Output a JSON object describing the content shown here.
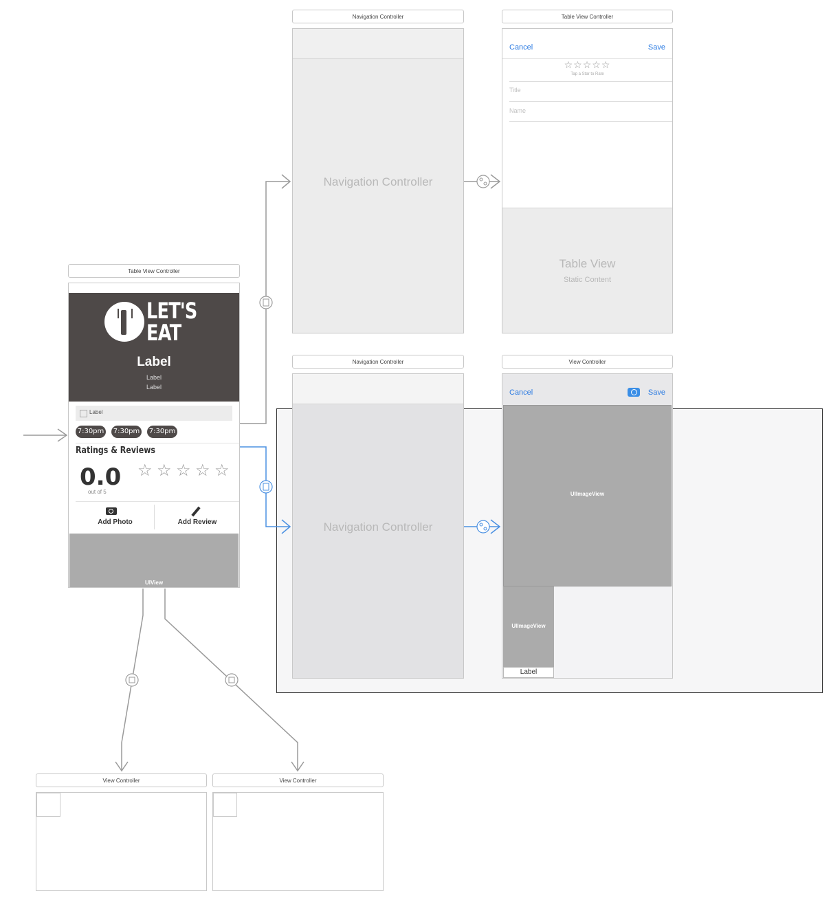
{
  "scenes": {
    "nav1_title": "Navigation Controller",
    "nav1_center": "Navigation Controller",
    "tvc_title": "Table View Controller",
    "tvc_cancel": "Cancel",
    "tvc_save": "Save",
    "tvc_rating_hint": "Tap a Star to Rate",
    "tvc_field_title": "Title",
    "tvc_field_name": "Name",
    "tvc_table_view": "Table View",
    "tvc_static": "Static Content",
    "main_title": "Table View Controller",
    "logo_top": "LET'S",
    "logo_bottom": "EAT",
    "header_label": "Label",
    "header_sub1": "Label",
    "header_sub2": "Label",
    "map_label": "Label",
    "times": [
      "7:30pm",
      "7:30pm",
      "7:30pm"
    ],
    "ratings_heading": "Ratings & Reviews",
    "rating_value": "0.0",
    "rating_out_of": "out of 5",
    "add_photo": "Add Photo",
    "add_review": "Add Review",
    "uiview": "UIView",
    "nav2_title": "Navigation Controller",
    "nav2_center": "Navigation Controller",
    "vc_title": "View Controller",
    "vc_cancel": "Cancel",
    "vc_save": "Save",
    "vc_image_big": "UIImageView",
    "vc_image_small": "UIImageView",
    "vc_label": "Label",
    "bottom_vc1_title": "View Controller",
    "bottom_vc2_title": "View Controller"
  },
  "colors": {
    "header_bg": "#4e4948",
    "segue_blue": "#4a90e2",
    "link_blue": "#2a7ae2"
  },
  "icons": [
    "camera-icon",
    "pencil-icon",
    "fork-icon",
    "star-icon",
    "segue-modal-icon",
    "segue-root-icon"
  ]
}
